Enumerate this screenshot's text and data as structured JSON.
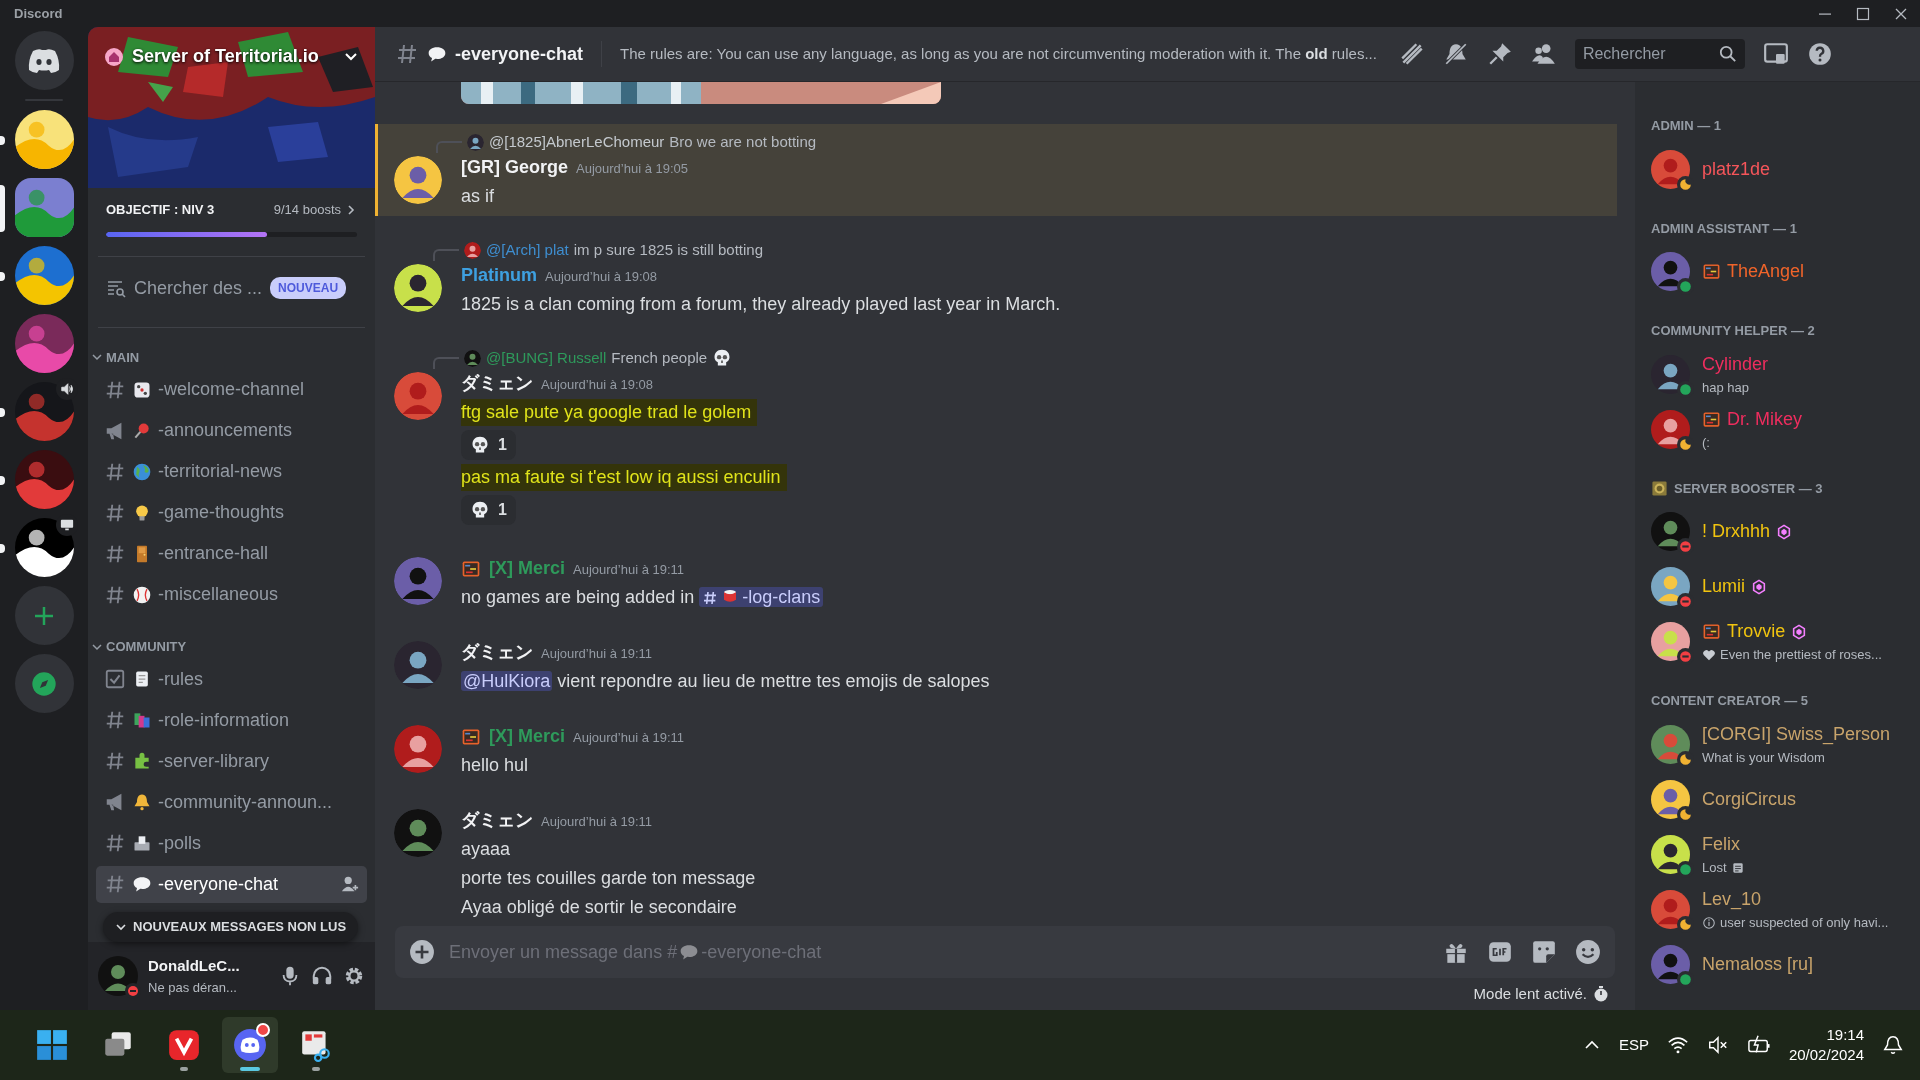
{
  "window": {
    "title": "Discord"
  },
  "servers": [
    {
      "selected": false,
      "unread": true
    },
    {
      "selected": true
    },
    {
      "selected": false,
      "unread": true
    },
    {
      "selected": false
    },
    {
      "selected": false,
      "unread": true,
      "in_voice": true
    },
    {
      "selected": false,
      "unread": true
    },
    {
      "selected": false,
      "unread": true,
      "streaming": true
    }
  ],
  "server": {
    "name": "Server of Territorial.io",
    "boost": {
      "goal": "OBJECTIF : NIV 3",
      "count": "9/14 boosts",
      "level": 0.64
    },
    "search": {
      "label": "Chercher des ...",
      "badge": "NOUVEAU"
    }
  },
  "categories": [
    {
      "name": "MAIN",
      "expanded": true,
      "channels": [
        {
          "kind": "text",
          "name": "-welcome-channel",
          "selected": false
        },
        {
          "kind": "announcement",
          "name": "-announcements",
          "selected": false
        },
        {
          "kind": "text",
          "name": "-territorial-news",
          "selected": false
        },
        {
          "kind": "text",
          "name": "-game-thoughts",
          "selected": false
        },
        {
          "kind": "text",
          "name": "-entrance-hall",
          "selected": false
        },
        {
          "kind": "text",
          "name": "-miscellaneous",
          "selected": false
        }
      ]
    },
    {
      "name": "COMMUNITY",
      "expanded": true,
      "channels": [
        {
          "kind": "rules",
          "name": "-rules",
          "selected": false
        },
        {
          "kind": "text",
          "name": "-role-information",
          "selected": false
        },
        {
          "kind": "text",
          "name": "-server-library",
          "selected": false
        },
        {
          "kind": "announcement",
          "name": "-community-announ...",
          "selected": false
        },
        {
          "kind": "text",
          "name": "-polls",
          "selected": false
        },
        {
          "kind": "text",
          "name": "-everyone-chat",
          "selected": true
        }
      ]
    }
  ],
  "unread_banner": "NOUVEAUX MESSAGES NON LUS",
  "user": {
    "name": "DonaldLeC...",
    "status_text": "Ne pas déran...",
    "status": {
      "kind": "dnd"
    }
  },
  "header": {
    "channel": "-everyone-chat",
    "topic": "The rules are: You can use any language, as long as you are not circumventing moderation with it. The **old** rules...",
    "search_placeholder": "Rechercher"
  },
  "messages": [
    {
      "author": "[GR] George",
      "color": "#f2f3f5",
      "time": "Aujourd’hui à 19:05",
      "mentioned": true,
      "reply": {
        "author": "@[1825]AbnerLeChomeur",
        "color": "#c4c9ce",
        "text": "Bro we are not botting"
      },
      "lines": [
        {
          "highlighted": false,
          "parts": [
            {
              "kind": "plain",
              "text": "as if"
            }
          ]
        }
      ]
    },
    {
      "author": "Platinum",
      "color": "#3ea0e0",
      "time": "Aujourd’hui à 19:08",
      "mentioned": false,
      "reply": {
        "author": "@[Arch] plat",
        "color": "#3e8ed0",
        "text": "im p sure 1825 is still botting"
      },
      "lines": [
        {
          "highlighted": false,
          "parts": [
            {
              "kind": "plain",
              "text": "1825 is a clan coming from a forum, they already played last year in March."
            }
          ]
        }
      ]
    },
    {
      "author": "ダミェン",
      "color": "#f2f3f5",
      "time": "Aujourd’hui à 19:08",
      "mentioned": false,
      "reply": {
        "author": "@[BUNG] Russell",
        "color": "#2e9a5b",
        "text": "French people",
        "trailing_icon": true
      },
      "lines": [
        {
          "highlighted": true,
          "parts": [
            {
              "kind": "plain",
              "text": "ftg sale pute ya google trad le golem"
            }
          ],
          "reactions": [
            {
              "count": "1"
            }
          ]
        },
        {
          "highlighted": true,
          "parts": [
            {
              "kind": "plain",
              "text": "pas ma faute si t'est low iq aussi enculin"
            }
          ],
          "reactions": [
            {
              "count": "1"
            }
          ]
        }
      ]
    },
    {
      "author": "[X] Merci",
      "color": "#2e9a5b",
      "role_icon": true,
      "time": "Aujourd’hui à 19:11",
      "mentioned": false,
      "lines": [
        {
          "highlighted": false,
          "parts": [
            {
              "kind": "plain",
              "text": "no games are being added in "
            },
            {
              "kind": "channel",
              "text": "-log-clans"
            }
          ]
        }
      ]
    },
    {
      "author": "ダミェン",
      "color": "#f2f3f5",
      "time": "Aujourd’hui à 19:11",
      "mentioned": false,
      "lines": [
        {
          "highlighted": false,
          "parts": [
            {
              "kind": "user",
              "text": "@HulKiora"
            },
            {
              "kind": "plain",
              "text": " vient repondre au lieu de mettre tes emojis de salopes"
            }
          ]
        }
      ]
    },
    {
      "author": "[X] Merci",
      "color": "#2e9a5b",
      "role_icon": true,
      "time": "Aujourd’hui à 19:11",
      "mentioned": false,
      "lines": [
        {
          "highlighted": false,
          "parts": [
            {
              "kind": "plain",
              "text": "hello hul"
            }
          ]
        }
      ]
    },
    {
      "author": "ダミェン",
      "color": "#f2f3f5",
      "time": "Aujourd’hui à 19:11",
      "mentioned": false,
      "lines": [
        {
          "highlighted": false,
          "parts": [
            {
              "kind": "plain",
              "text": "ayaaa"
            }
          ]
        },
        {
          "highlighted": false,
          "parts": [
            {
              "kind": "plain",
              "text": "porte tes couilles garde ton message"
            }
          ]
        },
        {
          "highlighted": false,
          "parts": [
            {
              "kind": "plain",
              "text": "Ayaa obligé de sortir le secondaire"
            }
          ]
        }
      ]
    }
  ],
  "composer": {
    "placeholder": {
      "prefix": "Envoyer un message dans #",
      "channel": "-everyone-chat"
    },
    "slow_mode": "Mode lent activé."
  },
  "member_groups": [
    {
      "name": "ADMIN — 1",
      "members": [
        {
          "name": "platz1de",
          "color": "#f5555a",
          "kind": "idle"
        }
      ]
    },
    {
      "name": "ADMIN ASSISTANT — 1",
      "members": [
        {
          "name": "TheAngel",
          "color": "#f0642a",
          "kind": "online",
          "role_icon": true
        }
      ]
    },
    {
      "name": "COMMUNITY HELPER — 2",
      "members": [
        {
          "name": "Cylinder",
          "color": "#ee2d5e",
          "kind": "online",
          "activity": {
            "text": "hap hap"
          }
        },
        {
          "name": "Dr. Mikey",
          "color": "#ee2d5e",
          "kind": "idle",
          "role_icon": true,
          "activity": {
            "text": "(:"
          }
        }
      ]
    },
    {
      "name": "SERVER BOOSTER — 3",
      "icon": true,
      "members": [
        {
          "name": "! Drxhhh",
          "color": "#f1c40f",
          "kind": "dnd",
          "booster": true
        },
        {
          "name": "Lumii",
          "color": "#f1c40f",
          "kind": "dnd",
          "booster": true
        },
        {
          "name": "Trovvie",
          "color": "#f1c40f",
          "kind": "dnd",
          "role_icon": true,
          "booster": true,
          "activity": {
            "text": "Even the prettiest of roses...",
            "icon_before": true
          }
        }
      ]
    },
    {
      "name": "CONTENT CREATOR — 5",
      "members": [
        {
          "name": "[CORGI] Swiss_Person",
          "color": "#c9a46b",
          "kind": "idle",
          "activity": {
            "text": "What is your Wisdom"
          }
        },
        {
          "name": "CorgiCircus",
          "color": "#c9a46b",
          "kind": "idle"
        },
        {
          "name": "Felix",
          "color": "#c9a46b",
          "kind": "online",
          "activity": {
            "text": "Lost",
            "icon_after": true
          }
        },
        {
          "name": "Lev_10",
          "color": "#c9a46b",
          "kind": "idle",
          "activity": {
            "text": "user suspected of only havi...",
            "icon_before": true
          }
        },
        {
          "name": "Nemaloss [ru]",
          "color": "#c9a46b",
          "kind": "online"
        }
      ]
    }
  ],
  "taskbar": {
    "apps": [
      {
        "kind": "start",
        "running": false,
        "active": false
      },
      {
        "kind": "taskview",
        "running": false,
        "active": false
      },
      {
        "kind": "browser",
        "running": true,
        "active": false
      },
      {
        "kind": "chat",
        "running": true,
        "active": true,
        "badge": true
      },
      {
        "kind": "snip",
        "running": true,
        "active": false
      }
    ],
    "language": "ESP",
    "time": "19:14",
    "date": "20/02/2024"
  }
}
